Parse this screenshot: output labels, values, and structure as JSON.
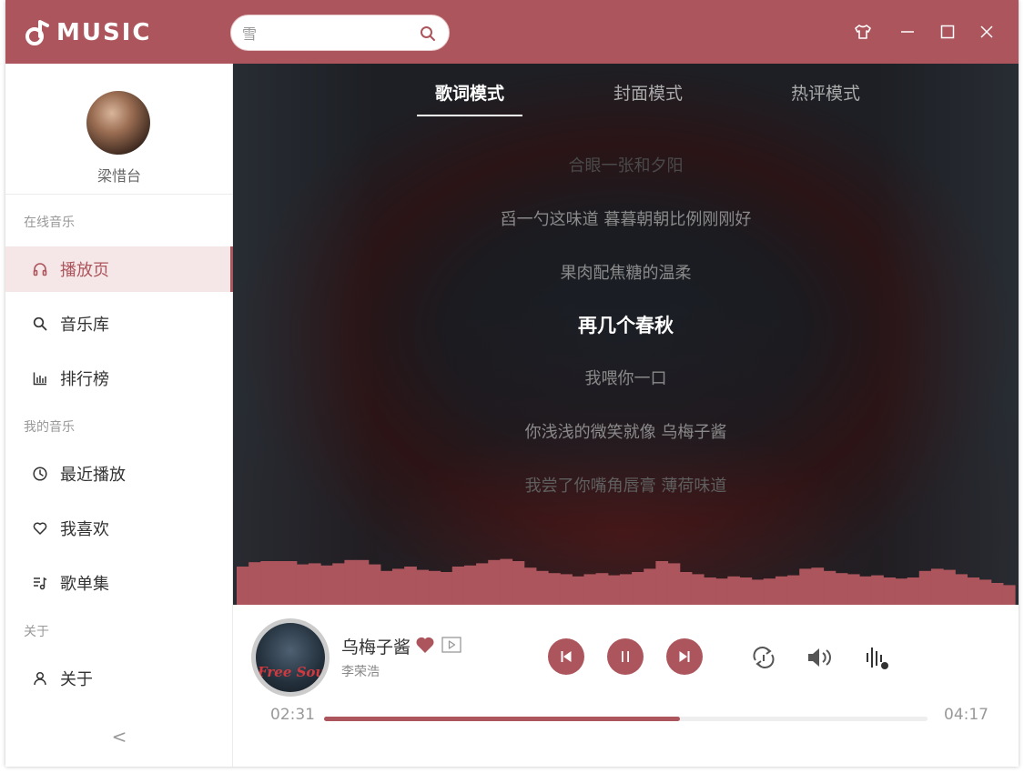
{
  "app": {
    "name": "MUSIC"
  },
  "search": {
    "placeholder": "雪"
  },
  "user": {
    "name": "梁惜台"
  },
  "sidebar": {
    "sections": [
      {
        "label": "在线音乐"
      },
      {
        "label": "我的音乐"
      },
      {
        "label": "关于"
      }
    ],
    "items": [
      {
        "label": "播放页",
        "icon": "headphones-icon",
        "active": true
      },
      {
        "label": "音乐库",
        "icon": "search-icon"
      },
      {
        "label": "排行榜",
        "icon": "bar-chart-icon"
      },
      {
        "label": "最近播放",
        "icon": "clock-icon"
      },
      {
        "label": "我喜欢",
        "icon": "heart-icon"
      },
      {
        "label": "歌单集",
        "icon": "playlist-icon"
      },
      {
        "label": "关于",
        "icon": "user-icon"
      }
    ],
    "collapse": "<"
  },
  "tabs": [
    {
      "label": "歌词模式",
      "active": true
    },
    {
      "label": "封面模式"
    },
    {
      "label": "热评模式"
    }
  ],
  "lyrics": [
    "合眼一张和夕阳",
    "舀一勺这味道 暮暮朝朝比例刚刚好",
    "果肉配焦糖的温柔",
    "再几个春秋",
    "我喂你一口",
    "你浅浅的微笑就像 乌梅子酱",
    "我尝了你嘴角唇膏 薄荷味道"
  ],
  "current_lyric_index": 3,
  "now_playing": {
    "title": "乌梅子酱",
    "artist": "李荣浩",
    "cover_text": "Free Soul",
    "liked": true,
    "elapsed": "02:31",
    "duration": "04:17",
    "progress": 0.59
  },
  "colors": {
    "accent": "#ac555c",
    "accent_light": "#f5e6e7"
  },
  "visualizer_levels": [
    0.7,
    0.78,
    0.8,
    0.8,
    0.8,
    0.74,
    0.76,
    0.72,
    0.76,
    0.82,
    0.82,
    0.74,
    0.62,
    0.66,
    0.7,
    0.64,
    0.62,
    0.6,
    0.7,
    0.72,
    0.76,
    0.82,
    0.84,
    0.8,
    0.68,
    0.62,
    0.58,
    0.56,
    0.52,
    0.56,
    0.58,
    0.54,
    0.56,
    0.6,
    0.66,
    0.8,
    0.76,
    0.6,
    0.56,
    0.5,
    0.48,
    0.52,
    0.5,
    0.46,
    0.48,
    0.52,
    0.54,
    0.66,
    0.68,
    0.62,
    0.58,
    0.56,
    0.52,
    0.54,
    0.5,
    0.48,
    0.5,
    0.62,
    0.66,
    0.64,
    0.56,
    0.5,
    0.46,
    0.4,
    0.36
  ]
}
